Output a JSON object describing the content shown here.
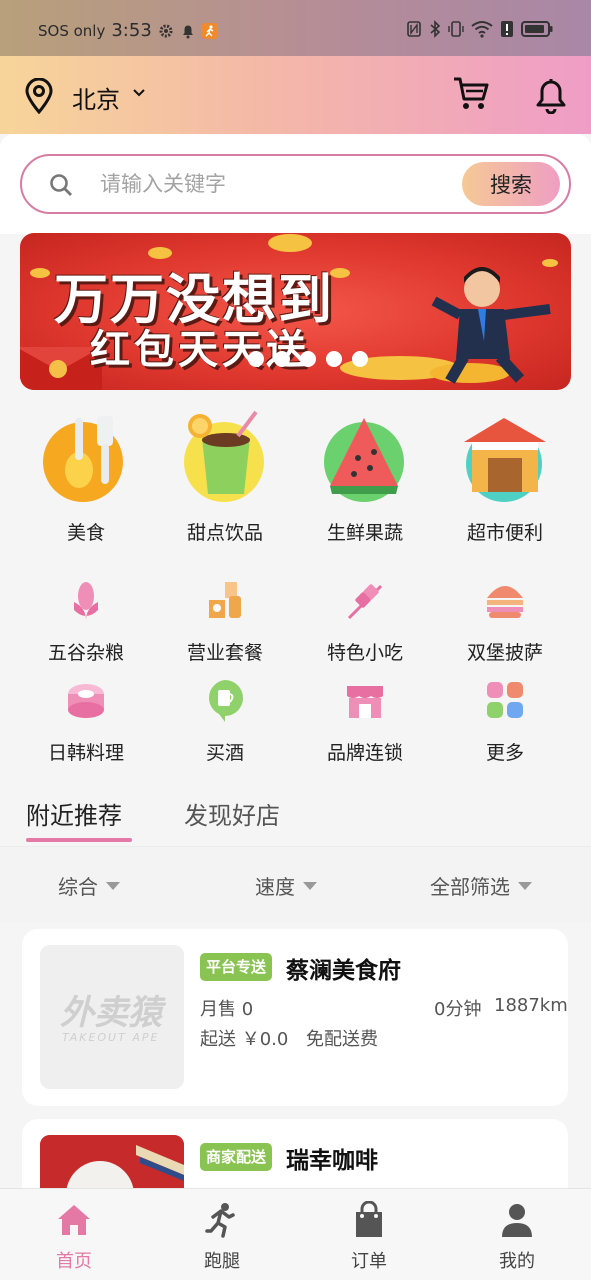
{
  "status_bar": {
    "network": "SOS only",
    "time": "3:53"
  },
  "header": {
    "city": "北京"
  },
  "search": {
    "placeholder": "请输入关键字",
    "button_label": "搜索"
  },
  "banner": {
    "line1": "万万没想到",
    "line2": "红包天天送"
  },
  "categories_primary": [
    {
      "label": "美食",
      "icon": "cutlery-icon"
    },
    {
      "label": "甜点饮品",
      "icon": "drink-icon"
    },
    {
      "label": "生鲜果蔬",
      "icon": "watermelon-icon"
    },
    {
      "label": "超市便利",
      "icon": "store-icon"
    }
  ],
  "categories_secondary": [
    {
      "label": "五谷杂粮",
      "icon": "corn-icon"
    },
    {
      "label": "营业套餐",
      "icon": "set-meal-icon"
    },
    {
      "label": "特色小吃",
      "icon": "skewer-icon"
    },
    {
      "label": "双堡披萨",
      "icon": "burger-icon"
    },
    {
      "label": "日韩料理",
      "icon": "sushi-icon"
    },
    {
      "label": "买酒",
      "icon": "beer-icon"
    },
    {
      "label": "品牌连锁",
      "icon": "shop-icon"
    },
    {
      "label": "更多",
      "icon": "grid-icon"
    }
  ],
  "tabs": [
    {
      "label": "附近推荐",
      "active": true
    },
    {
      "label": "发现好店",
      "active": false
    }
  ],
  "filters": [
    {
      "label": "综合"
    },
    {
      "label": "速度"
    },
    {
      "label": "全部筛选"
    }
  ],
  "shops": [
    {
      "badge": "平台专送",
      "name": "蔡澜美食府",
      "monthly_sales": "月售 0",
      "time": "0分钟",
      "distance": "1887km",
      "min_order": "起送 ￥0.0",
      "delivery_fee": "免配送费",
      "thumb_text": "外卖猿",
      "thumb_sub": "TAKEOUT APE"
    },
    {
      "badge": "商家配送",
      "name": "瑞幸咖啡"
    }
  ],
  "bottom_nav": [
    {
      "label": "首页",
      "icon": "home-icon",
      "active": true
    },
    {
      "label": "跑腿",
      "icon": "runner-icon",
      "active": false
    },
    {
      "label": "订单",
      "icon": "bag-icon",
      "active": false
    },
    {
      "label": "我的",
      "icon": "user-icon",
      "active": false
    }
  ],
  "colors": {
    "accent": "#e579a6",
    "badge_green": "#89c351"
  }
}
